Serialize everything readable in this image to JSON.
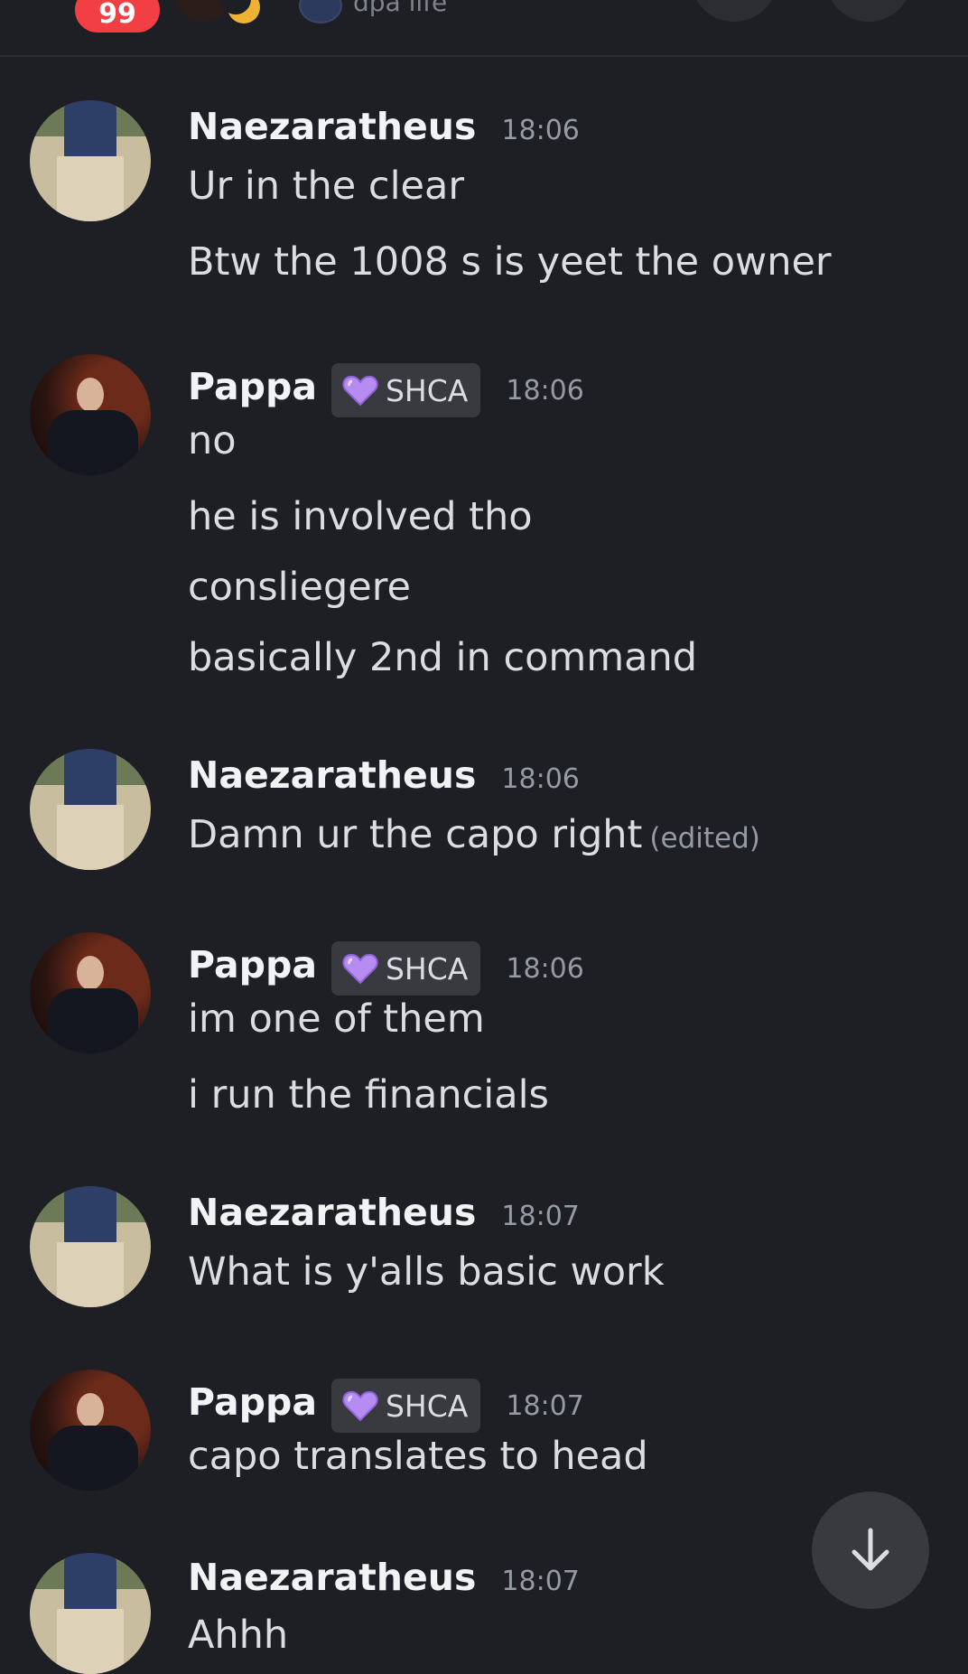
{
  "topbar": {
    "badge_count": "99",
    "server_name": "dpa life"
  },
  "role": {
    "label": "SHCA",
    "color": "#b68cf2"
  },
  "messages": [
    {
      "author": "Naezaratheus",
      "time": "18:06",
      "lines": [
        "Ur in the clear",
        "Btw the 1008 s is yeet the owner"
      ]
    },
    {
      "author": "Pappa",
      "time": "18:06",
      "role": "SHCA",
      "lines": [
        "no",
        "he is involved tho",
        "consliegere",
        "basically 2nd in command"
      ]
    },
    {
      "author": "Naezaratheus",
      "time": "18:06",
      "lines": [
        "Damn ur the capo right"
      ],
      "edited": "(edited)"
    },
    {
      "author": "Pappa",
      "time": "18:06",
      "role": "SHCA",
      "lines": [
        "im one of them",
        "i run the financials"
      ]
    },
    {
      "author": "Naezaratheus",
      "time": "18:07",
      "lines": [
        "What is y'alls basic work"
      ]
    },
    {
      "author": "Pappa",
      "time": "18:07",
      "role": "SHCA",
      "lines": [
        "capo translates to head"
      ]
    },
    {
      "author": "Naezaratheus",
      "time": "18:07",
      "lines": [
        "Ahhh"
      ]
    }
  ],
  "icons": {
    "scroll_down": "arrow-down-icon",
    "role_icon": "heart-icon"
  }
}
